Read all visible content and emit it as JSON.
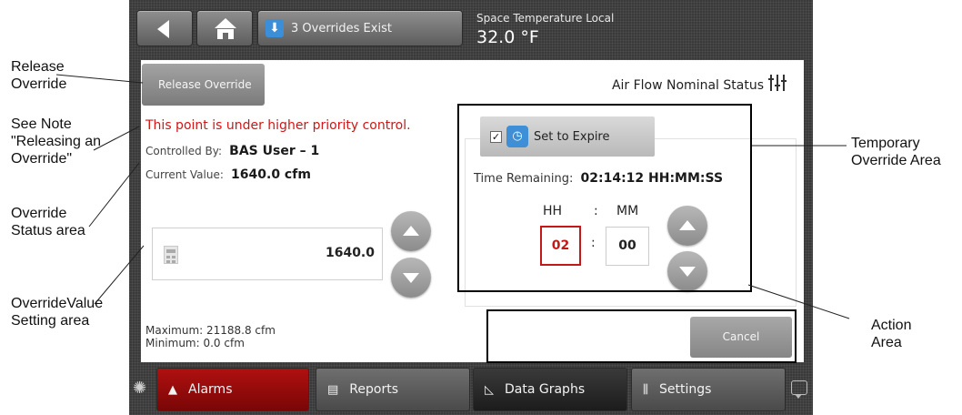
{
  "topbar": {
    "overrides_label": "3 Overrides Exist",
    "space_label": "Space Temperature Local",
    "space_value": "32.0 °F"
  },
  "panel": {
    "release_label": "Release Override",
    "airflow_label": "Air Flow Nominal Status",
    "warning": "This point is under higher priority control.",
    "controlled_by_label": "Controlled By:",
    "controlled_by_value": "BAS User – 1",
    "current_value_label": "Current Value:",
    "current_value": "1640.0 cfm",
    "input_value": "1640.0",
    "maximum": "Maximum: 21188.8 cfm",
    "minimum": "Minimum: 0.0 cfm"
  },
  "expire": {
    "label": "Set to Expire",
    "checked": true,
    "checkbox_glyph": "✓",
    "time_remaining_label": "Time Remaining:",
    "time_remaining_value": "02:14:12 HH:MM:SS",
    "hh_label": "HH",
    "separator": ":",
    "mm_label": "MM",
    "hh_value": "02",
    "mm_value": "00"
  },
  "action": {
    "cancel_label": "Cancel"
  },
  "bottom_tabs": [
    {
      "label": "Alarms",
      "icon": "bell-icon"
    },
    {
      "label": "Reports",
      "icon": "document-icon"
    },
    {
      "label": "Data Graphs",
      "icon": "chart-icon"
    },
    {
      "label": "Settings",
      "icon": "settings-icon"
    }
  ],
  "annotations": {
    "release_override": "Release Override",
    "see_note": "See Note \"Releasing an Override\"",
    "override_status": "Override Status area",
    "override_value": "OverrideValue Setting area",
    "temporary_override": "Temporary Override Area",
    "action_area": "Action Area"
  },
  "colors": {
    "alarm_red": "#b01010",
    "warning_red": "#d01616",
    "accent_blue": "#3a8fd8"
  }
}
